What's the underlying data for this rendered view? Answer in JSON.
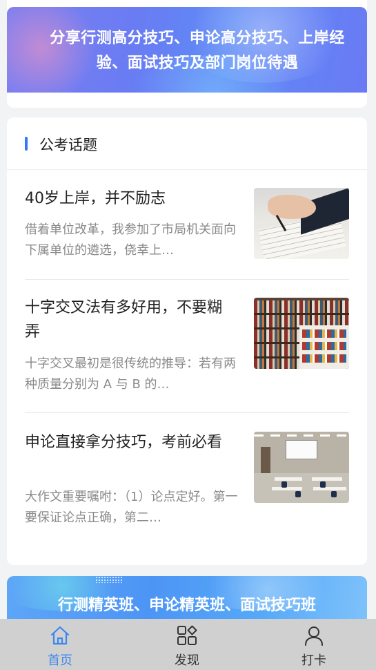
{
  "top_banner": {
    "text": "分享行测高分技巧、申论高分技巧、上岸经验、面试技巧及部门岗位待遇"
  },
  "topic_section": {
    "title": "公考话题",
    "articles": [
      {
        "title": "40岁上岸，并不励志",
        "summary": "借着单位改革，我参加了市局机关面向下属单位的遴选，侥幸上…",
        "thumbnail": "writing-hand-image"
      },
      {
        "title": "十字交叉法有多好用，不要糊弄",
        "summary": "十字交叉最初是很传统的推导：若有两种质量分别为 A 与 B 的…",
        "thumbnail": "bookshelf-image"
      },
      {
        "title": "申论直接拿分技巧，考前必看",
        "summary": "大作文重要嘱咐：（1）论点定好。第一要保证论点正确，第二…",
        "thumbnail": "classroom-image"
      }
    ]
  },
  "bottom_banner": {
    "text": "行测精英班、申论精英班、面试技巧班"
  },
  "tabbar": {
    "active_color": "#3b86f0",
    "tabs": [
      {
        "label": "首页",
        "icon": "home-icon",
        "active": true
      },
      {
        "label": "发现",
        "icon": "discover-icon",
        "active": false
      },
      {
        "label": "打卡",
        "icon": "user-icon",
        "active": false
      }
    ]
  }
}
